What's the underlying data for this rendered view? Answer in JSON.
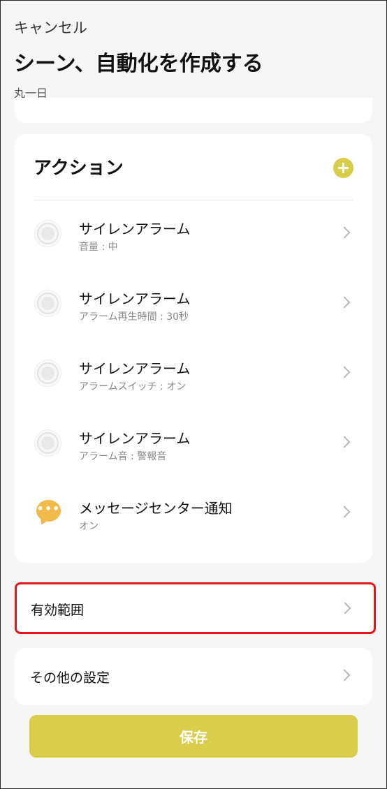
{
  "header": {
    "cancel_label": "キャンセル",
    "title": "シーン、自動化を作成する",
    "subtitle": "丸一日"
  },
  "actions": {
    "header": "アクション",
    "add_icon": "plus-circle-icon",
    "items": [
      {
        "icon": "siren-icon",
        "title": "サイレンアラーム",
        "subtitle": "音量 : 中"
      },
      {
        "icon": "siren-icon",
        "title": "サイレンアラーム",
        "subtitle": "アラーム再生時間 : 30秒"
      },
      {
        "icon": "siren-icon",
        "title": "サイレンアラーム",
        "subtitle": "アラームスイッチ : オン"
      },
      {
        "icon": "siren-icon",
        "title": "サイレンアラーム",
        "subtitle": "アラーム音 : 警報音"
      },
      {
        "icon": "message-icon",
        "title": "メッセージセンター通知",
        "subtitle": "オン"
      }
    ]
  },
  "scope": {
    "label": "有効範囲"
  },
  "other_settings": {
    "label": "その他の設定"
  },
  "save_label": "保存",
  "colors": {
    "accent": "#d9cd4b",
    "highlight_border": "#e5141b",
    "message_icon": "#f0bb4a",
    "background": "#f6f6f6"
  }
}
